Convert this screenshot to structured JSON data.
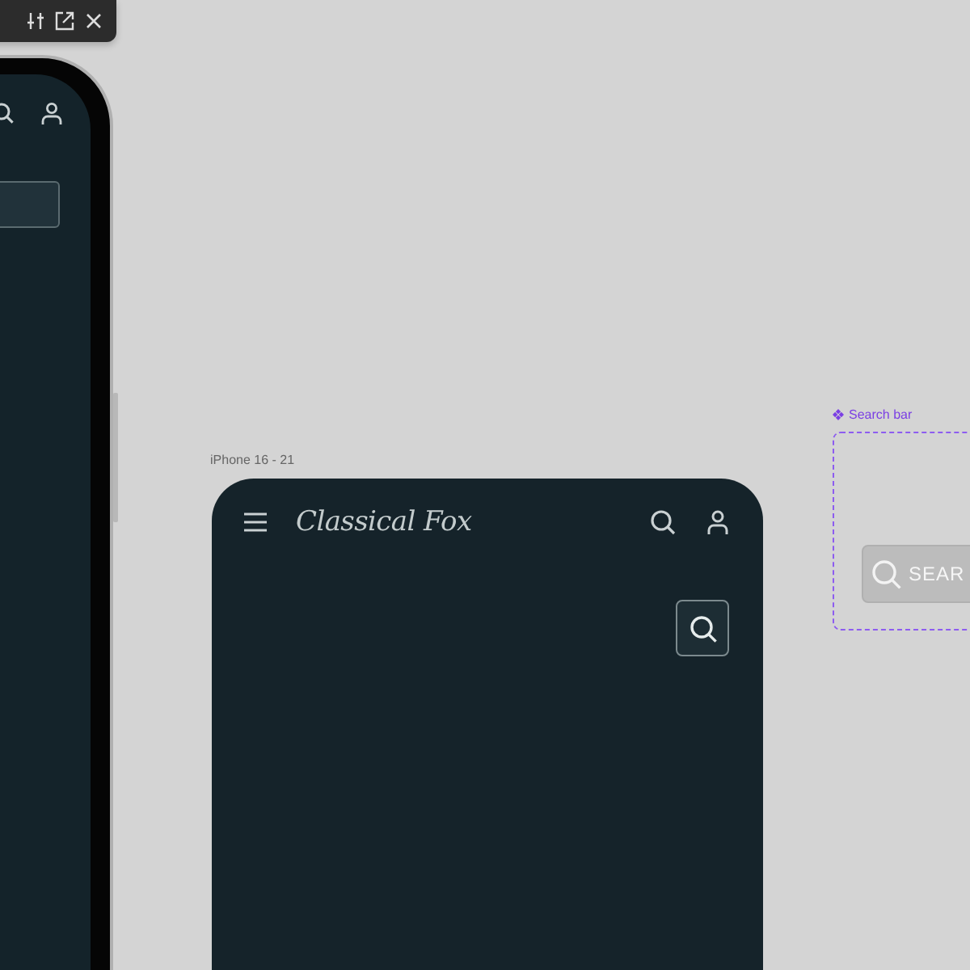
{
  "frame": {
    "label": "iPhone 16 - 21",
    "header": {
      "title": "Classical Fox"
    }
  },
  "component": {
    "label": "Search bar",
    "search": {
      "placeholder": "SEAR"
    }
  }
}
